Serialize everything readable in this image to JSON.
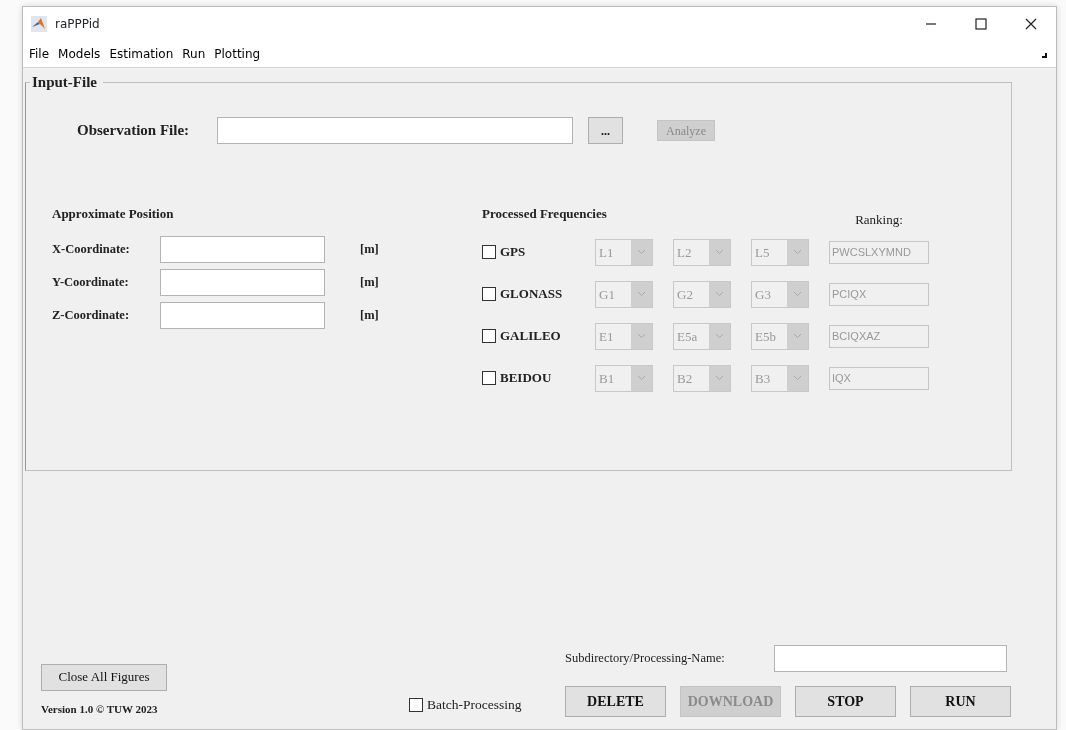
{
  "window": {
    "title": "raPPPid"
  },
  "menu": [
    "File",
    "Models",
    "Estimation",
    "Run",
    "Plotting"
  ],
  "input_panel": {
    "title": "Input-File",
    "observation_file": {
      "label": "Observation File:",
      "browse_button": "...",
      "analyze_button": {
        "label": "Analyze",
        "disabled": true
      }
    },
    "approximate_position": {
      "title": "Approximate Position",
      "rows": [
        {
          "label": "X-Coordinate:",
          "unit": "[m]"
        },
        {
          "label": "Y-Coordinate:",
          "unit": "[m]"
        },
        {
          "label": "Z-Coordinate:",
          "unit": "[m]"
        }
      ]
    },
    "processed_frequencies": {
      "title": "Processed Frequencies",
      "ranking_label": "Ranking:",
      "systems": [
        {
          "name": "GPS",
          "checked": false,
          "disabled": true,
          "frequencies": [
            "L1",
            "L2",
            "L5"
          ],
          "ranking": "PWCSLXYMND"
        },
        {
          "name": "GLONASS",
          "checked": false,
          "disabled": true,
          "frequencies": [
            "G1",
            "G2",
            "G3"
          ],
          "ranking": "PCIQX"
        },
        {
          "name": "GALILEO",
          "checked": false,
          "disabled": true,
          "frequencies": [
            "E1",
            "E5a",
            "E5b"
          ],
          "ranking": "BCIQXAZ"
        },
        {
          "name": "BEIDOU",
          "checked": false,
          "disabled": true,
          "frequencies": [
            "B1",
            "B2",
            "B3"
          ],
          "ranking": "IQX"
        }
      ]
    }
  },
  "close_all_button": "Close All Figures",
  "version": "Version 1.0 © TUW 2023",
  "batch_processing": {
    "label": "Batch-Processing",
    "checked": false
  },
  "subdirectory_label": "Subdirectory/Processing-Name:",
  "buttons": [
    {
      "label": "DELETE",
      "disabled": false
    },
    {
      "label": "DOWNLOAD",
      "disabled": true
    },
    {
      "label": "STOP",
      "disabled": false
    },
    {
      "label": "RUN",
      "disabled": false
    }
  ]
}
